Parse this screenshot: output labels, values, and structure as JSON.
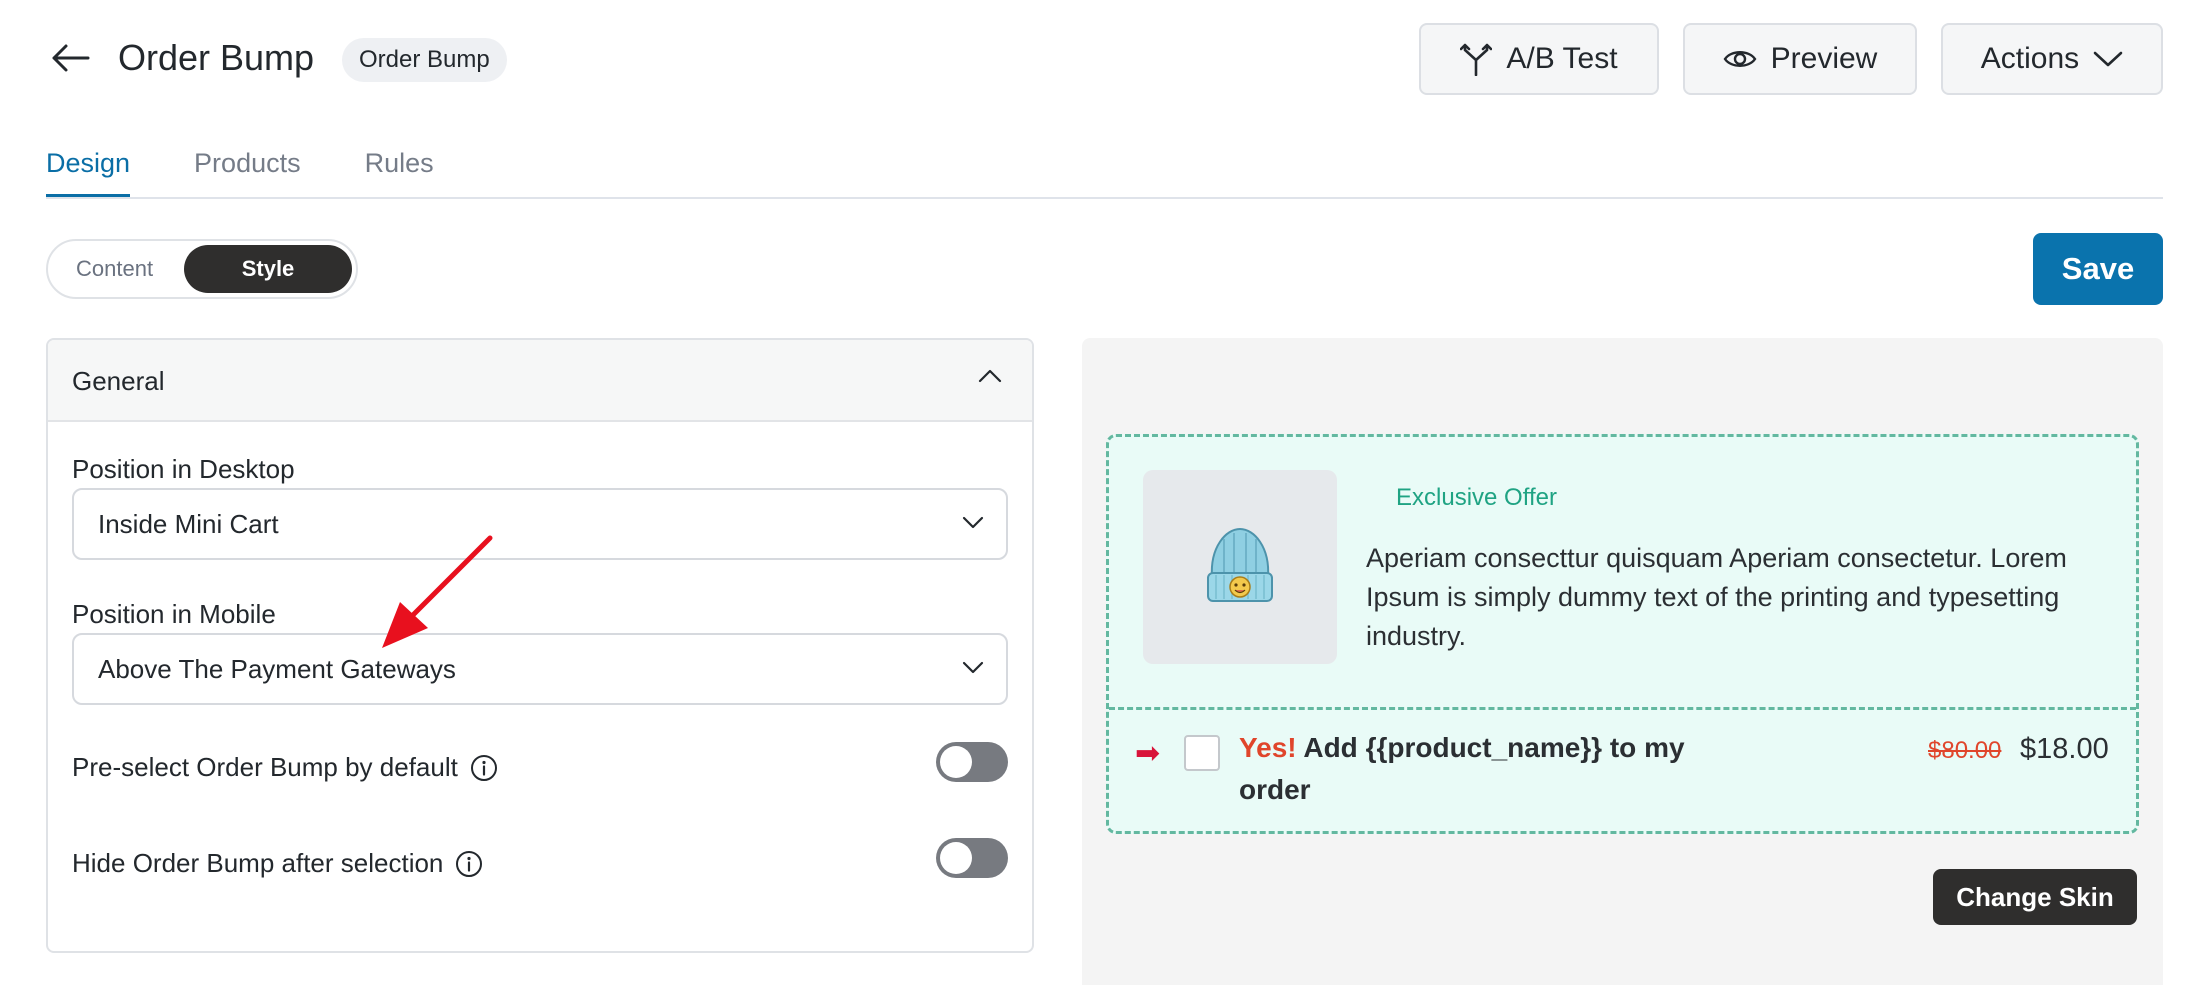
{
  "header": {
    "title": "Order Bump",
    "badge": "Order Bump",
    "ab_test_label": "A/B Test",
    "preview_label": "Preview",
    "actions_label": "Actions"
  },
  "tabs": [
    {
      "label": "Design",
      "active": true
    },
    {
      "label": "Products",
      "active": false
    },
    {
      "label": "Rules",
      "active": false
    }
  ],
  "segment": {
    "content_label": "Content",
    "style_label": "Style",
    "selected": "Style"
  },
  "save_label": "Save",
  "general": {
    "title": "General",
    "desktop_label": "Position in Desktop",
    "desktop_value": "Inside Mini Cart",
    "mobile_label": "Position in Mobile",
    "mobile_value": "Above The Payment Gateways",
    "preselect_label": "Pre-select Order Bump by default",
    "preselect_on": false,
    "hide_label": "Hide Order Bump after selection",
    "hide_on": false
  },
  "preview": {
    "offer_title": "Exclusive Offer",
    "description": "Aperiam consecttur quisquam Aperiam consectetur. Lorem Ipsum is simply dummy text of the printing and typesetting industry.",
    "yes_label": "Yes!",
    "add_text": "Add {{product_name}} to my order",
    "old_price": "$80.00",
    "new_price": "$18.00",
    "change_skin_label": "Change Skin"
  },
  "colors": {
    "accent": "#0a73ad",
    "offer_green": "#1fa383",
    "bump_border": "#63b8a0",
    "bump_bg": "#e9fbf7",
    "highlight_red": "#e0452b",
    "annotation_red": "#e8101e"
  },
  "icons": {
    "back": "arrow-left-icon",
    "ab_test": "split-arrows-icon",
    "preview": "eye-icon",
    "actions": "chevron-down-icon",
    "panel": "chevron-up-icon",
    "info": "info-circle-icon",
    "bump_arrow": "right-arrow-icon",
    "product": "beanie-hat-image"
  }
}
